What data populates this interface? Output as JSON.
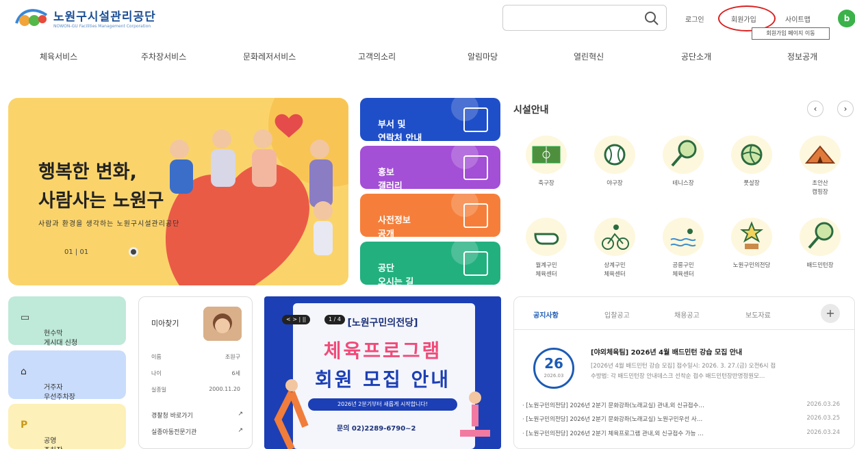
{
  "header": {
    "logo_ko": "노원구시설관리공단",
    "logo_en": "NOWON-GU Facilities Management Corporation",
    "links": {
      "login": "로그인",
      "signup": "회원가입",
      "sitemap": "사이트맵"
    },
    "user_initial": "b",
    "tooltip": "회원가입 페이지 이동"
  },
  "nav": [
    "체육서비스",
    "주차장서비스",
    "문화레저서비스",
    "고객의소리",
    "알림마당",
    "열린혁신",
    "공단소개",
    "정보공개"
  ],
  "hero": {
    "title": "행복한 변화,\n사람사는 노원구",
    "subtitle": "사람과 환경을 생각하는 노원구시설관리공단",
    "pager": "01 | 01"
  },
  "quick": [
    {
      "label": "부서 및\n연락처 안내",
      "color": "#1f4fc8"
    },
    {
      "label": "홍보\n갤러리",
      "color": "#a34fd6"
    },
    {
      "label": "사전정보\n공개",
      "color": "#f57f3a"
    },
    {
      "label": "공단\n오시는 길",
      "color": "#22b07f"
    }
  ],
  "facilities": {
    "title": "시설안내",
    "items": [
      {
        "label": "축구장",
        "icon": "soccer-field-icon"
      },
      {
        "label": "야구장",
        "icon": "baseball-icon"
      },
      {
        "label": "테니스장",
        "icon": "tennis-racket-icon"
      },
      {
        "label": "풋살장",
        "icon": "volleyball-icon"
      },
      {
        "label": "초안산\n캠핑장",
        "icon": "tent-icon"
      },
      {
        "label": "월계구민\n체육센터",
        "icon": "whistle-icon"
      },
      {
        "label": "상계구민\n체육센터",
        "icon": "cyclist-icon"
      },
      {
        "label": "공릉구민\n체육센터",
        "icon": "swimmer-icon"
      },
      {
        "label": "노원구민의전당",
        "icon": "trophy-icon"
      },
      {
        "label": "배드민턴장",
        "icon": "badminton-racket-icon"
      }
    ]
  },
  "tiles": [
    {
      "label": "현수막\n게시대 신청",
      "icon": "banner-stand-icon",
      "color": "#bfe9d9"
    },
    {
      "label": "거주자\n우선주차장",
      "icon": "house-icon",
      "color": "#c9dcfb"
    },
    {
      "label": "공영\n주차장",
      "icon": "parking-icon",
      "color": "#fdf0b8"
    }
  ],
  "missing": {
    "title": "미아찾기",
    "rows": [
      {
        "k": "이름",
        "v": "조원구"
      },
      {
        "k": "나이",
        "v": "6세"
      },
      {
        "k": "실종일",
        "v": "2000.11.20"
      }
    ],
    "links": [
      "경찰청 바로가기",
      "실종아동전문기관"
    ]
  },
  "banner": {
    "controls": "< > | ||",
    "count": "1 / 4",
    "heading": "[노원구민의전당]",
    "main1": "체육프로그램",
    "main2": "회원 모집 안내",
    "pill": "2026년 2분기부터 새롭게 시작합니다!",
    "contact": "문의 02)2289-6790~2"
  },
  "notices": {
    "tabs": [
      "공지사항",
      "입찰공고",
      "채용공고",
      "보도자료"
    ],
    "featured": {
      "day": "26",
      "ym": "2026.03",
      "title": "[야외체육팀] 2026년 4월 배드민턴 강습 모집 안내",
      "body": "[2026년 4월 배드민턴 강습 모집]    접수일시: 2026. 3. 27.(금) 오전6시 접\n수방법: 각 배드민턴장 안내데스크 선착순 접수    배드민턴장반명정원모…"
    },
    "list": [
      {
        "t": "· [노원구민의전당] 2026년 2분기 문화강좌(노래교실) 관내,외 신규접수…",
        "d": "2026.03.26"
      },
      {
        "t": "· [노원구민의전당] 2026년 2분기 문화강좌(노래교실) 노원구민우선 사…",
        "d": "2026.03.25"
      },
      {
        "t": "· [노원구민의전당] 2026년 2분기 체육프로그램 관내,외 신규접수 가능 …",
        "d": "2026.03.24"
      }
    ]
  }
}
